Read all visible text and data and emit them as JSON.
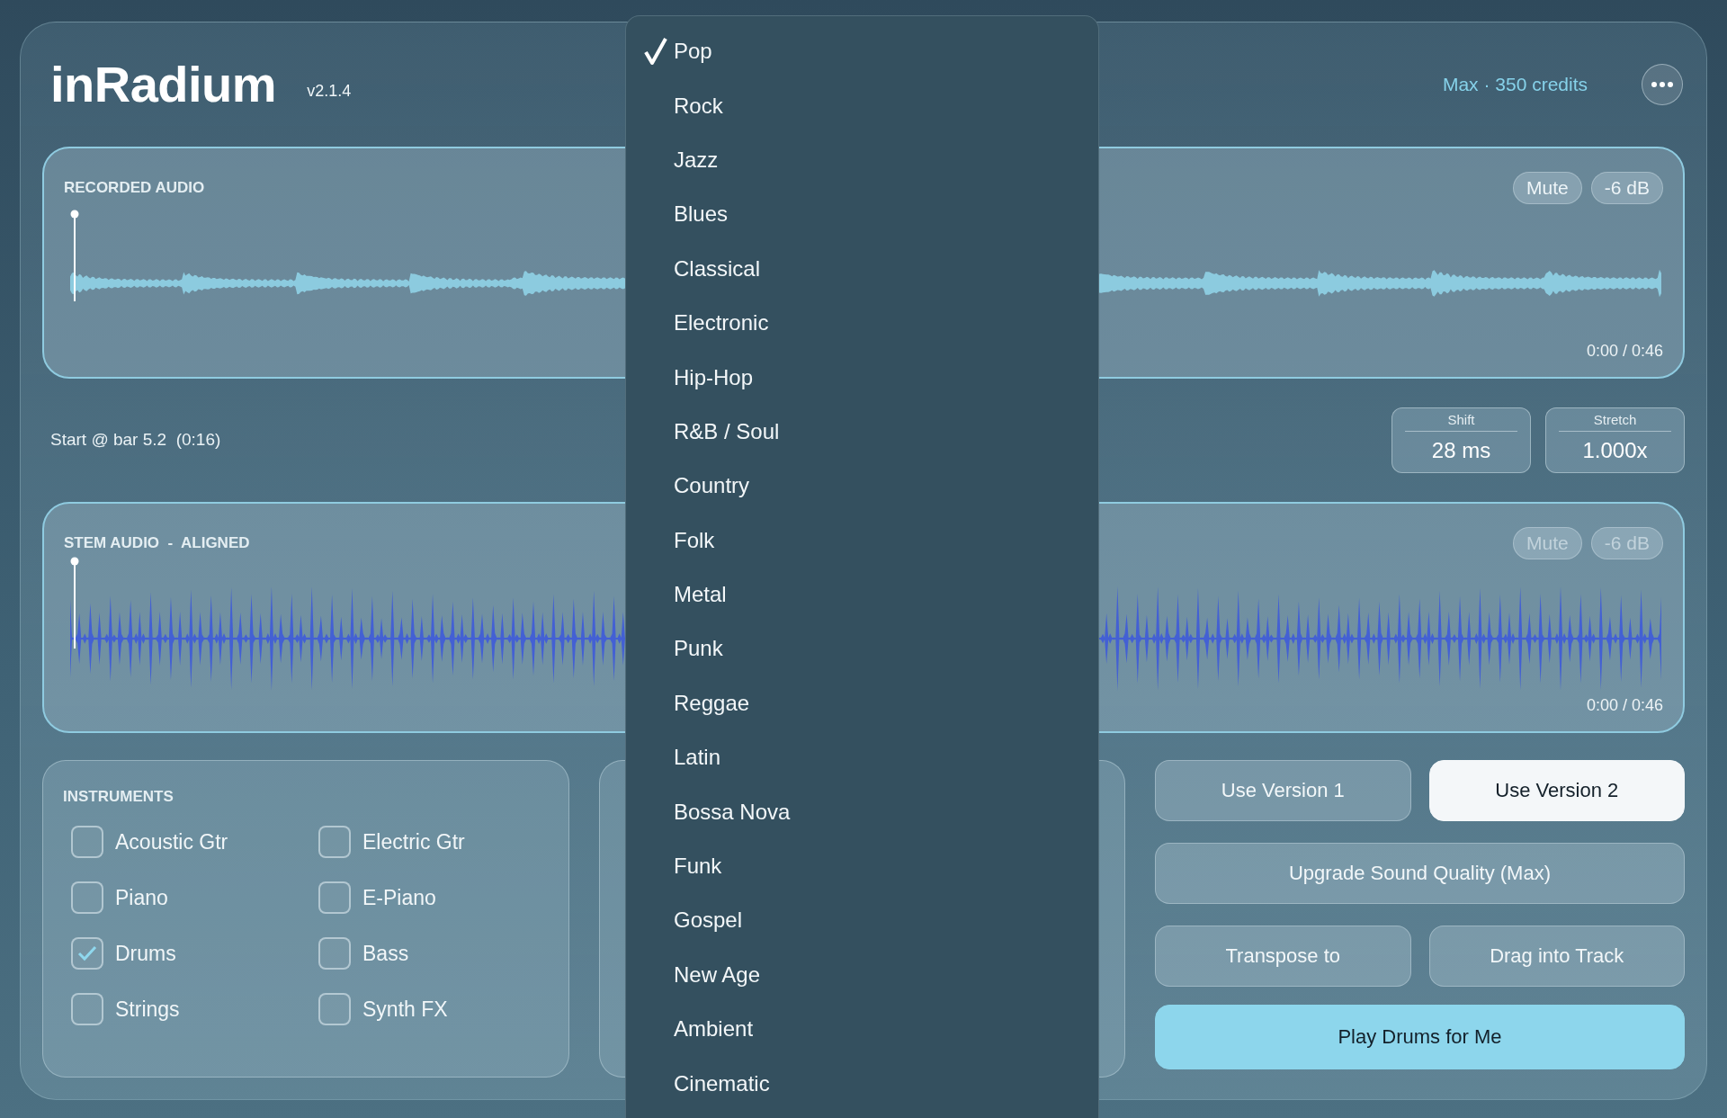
{
  "app": {
    "name": "inRadium",
    "version": "v2.1.4",
    "plan": "Max · 350 credits"
  },
  "recorded": {
    "title": "RECORDED AUDIO",
    "mute": "Mute",
    "gain": "-6 dB",
    "disabled": false,
    "time": "0:00 / 0:46",
    "kind": "soft"
  },
  "start_info": "Start @ bar 5.2  (0:16)",
  "adjust": [
    {
      "label": "Shift",
      "value": "28 ms"
    },
    {
      "label": "Stretch",
      "value": "1.000x"
    }
  ],
  "stem": {
    "title": "STEM AUDIO  -  ALIGNED",
    "mute": "Mute",
    "gain": "-6 dB",
    "disabled": true,
    "time": "0:00 / 0:46",
    "kind": "drums"
  },
  "instruments": {
    "title": "INSTRUMENTS",
    "items": [
      {
        "label": "Acoustic Gtr",
        "checked": false
      },
      {
        "label": "Electric Gtr",
        "checked": false
      },
      {
        "label": "Piano",
        "checked": false
      },
      {
        "label": "E-Piano",
        "checked": false
      },
      {
        "label": "Drums",
        "checked": true
      },
      {
        "label": "Bass",
        "checked": false
      },
      {
        "label": "Strings",
        "checked": false
      },
      {
        "label": "Synth FX",
        "checked": false
      }
    ]
  },
  "versions": [
    {
      "label": "Use Version 1",
      "selected": false
    },
    {
      "label": "Use Version 2",
      "selected": true
    }
  ],
  "actions": [
    {
      "label": "Upgrade Sound Quality (Max)",
      "kind": "wide"
    },
    {
      "label": "Transpose to",
      "kind": "half"
    },
    {
      "label": "Drag into Track",
      "kind": "half"
    },
    {
      "label": "Play Drums for Me",
      "kind": "primary"
    }
  ],
  "genre_menu": [
    {
      "label": "Pop",
      "selected": true
    },
    {
      "label": "Rock",
      "selected": false
    },
    {
      "label": "Jazz",
      "selected": false
    },
    {
      "label": "Blues",
      "selected": false
    },
    {
      "label": "Classical",
      "selected": false
    },
    {
      "label": "Electronic",
      "selected": false
    },
    {
      "label": "Hip-Hop",
      "selected": false
    },
    {
      "label": "R&B / Soul",
      "selected": false
    },
    {
      "label": "Country",
      "selected": false
    },
    {
      "label": "Folk",
      "selected": false
    },
    {
      "label": "Metal",
      "selected": false
    },
    {
      "label": "Punk",
      "selected": false
    },
    {
      "label": "Reggae",
      "selected": false
    },
    {
      "label": "Latin",
      "selected": false
    },
    {
      "label": "Bossa Nova",
      "selected": false
    },
    {
      "label": "Funk",
      "selected": false
    },
    {
      "label": "Gospel",
      "selected": false
    },
    {
      "label": "New Age",
      "selected": false
    },
    {
      "label": "Ambient",
      "selected": false
    },
    {
      "label": "Cinematic",
      "selected": false
    }
  ]
}
